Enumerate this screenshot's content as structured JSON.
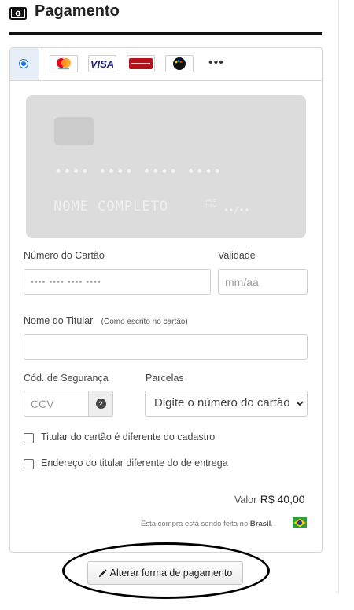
{
  "section": {
    "title": "Pagamento",
    "icon": "money-bill-icon"
  },
  "payment_methods": {
    "selected": true,
    "brands": [
      {
        "name": "Mastercard",
        "icon": "mastercard-icon"
      },
      {
        "name": "VISA",
        "icon": "visa-icon"
      },
      {
        "name": "Hipercard",
        "icon": "hipercard-icon"
      },
      {
        "name": "elo",
        "icon": "elo-icon"
      }
    ],
    "more": "•••"
  },
  "card_preview": {
    "number": "•••• •••• •••• ••••",
    "name": "NOME COMPLETO",
    "valid_thru": "VALID THRU",
    "expiry": "••/••"
  },
  "form": {
    "card_number": {
      "label": "Número do Cartão",
      "placeholder": "•••• •••• •••• ••••"
    },
    "expiry": {
      "label": "Validade",
      "placeholder": "mm/aa"
    },
    "holder": {
      "label": "Nome do Titular",
      "hint": "(Como escrito no cartão)",
      "value": ""
    },
    "security": {
      "label": "Cód. de Segurança",
      "placeholder": "CCV",
      "help": "?"
    },
    "installments": {
      "label": "Parcelas",
      "selected": "Digite o número do cartão"
    },
    "checkboxes": [
      {
        "label": "Titular do cartão é diferente do cadastro",
        "checked": false
      },
      {
        "label": "Endereço do titular diferente do de entrega",
        "checked": false
      }
    ]
  },
  "summary": {
    "total_label": "Valor",
    "total_value": "R$ 40,00",
    "country_prefix": "Esta compra está sendo feita no",
    "country_name": "Brasil",
    "country_suffix": "."
  },
  "change_button": {
    "label": "Alterar forma de pagamento",
    "icon": "pencil-icon"
  },
  "colors": {
    "accent": "#1a73e8",
    "rule": "#111111"
  }
}
